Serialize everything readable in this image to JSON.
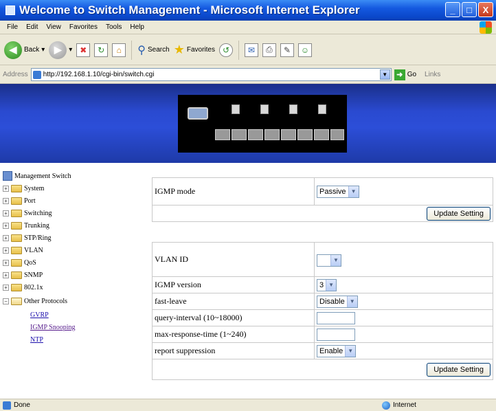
{
  "window": {
    "title": "Welcome to Switch Management - Microsoft Internet Explorer",
    "buttons": {
      "minimize": "_",
      "maximize": "□",
      "close": "X"
    }
  },
  "menu": [
    "File",
    "Edit",
    "View",
    "Favorites",
    "Tools",
    "Help"
  ],
  "toolbar": {
    "back": "Back",
    "search": "Search",
    "favorites": "Favorites"
  },
  "address": {
    "label": "Address",
    "url": "http://192.168.1.10/cgi-bin/switch.cgi",
    "go": "Go",
    "links": "Links"
  },
  "tree": {
    "root": "Management Switch",
    "folders": [
      "System",
      "Port",
      "Switching",
      "Trunking",
      "STP/Ring",
      "VLAN",
      "QoS",
      "SNMP",
      "802.1x",
      "Other Protocols"
    ],
    "links": [
      "GVRP",
      "IGMP Snooping",
      "NTP"
    ]
  },
  "form1": {
    "igmp_mode_label": "IGMP mode",
    "igmp_mode_value": "Passive",
    "update_button": "Update Setting"
  },
  "form2": {
    "vlan_id_label": "VLAN ID",
    "vlan_id_value": "",
    "igmp_version_label": "IGMP version",
    "igmp_version_value": "3",
    "fast_leave_label": "fast-leave",
    "fast_leave_value": "Disable",
    "query_interval_label": "query-interval (10~18000)",
    "query_interval_value": "",
    "max_response_label": "max-response-time (1~240)",
    "max_response_value": "",
    "report_suppression_label": "report suppression",
    "report_suppression_value": "Enable",
    "update_button": "Update Setting"
  },
  "status": {
    "left": "Done",
    "zone": "Internet"
  },
  "icons": {
    "back": "back-arrow-icon",
    "forward": "forward-arrow-icon",
    "stop": "stop-icon",
    "refresh": "refresh-icon",
    "home": "home-icon",
    "search": "search-icon",
    "favorites": "star-icon",
    "history": "history-icon",
    "mail": "mail-icon",
    "print": "print-icon",
    "messenger": "messenger-icon",
    "folder": "folder-icon"
  },
  "colors": {
    "titlebar": "#0a46c8",
    "banner": "#2c4ed8",
    "visited_link": "#551a8b"
  }
}
